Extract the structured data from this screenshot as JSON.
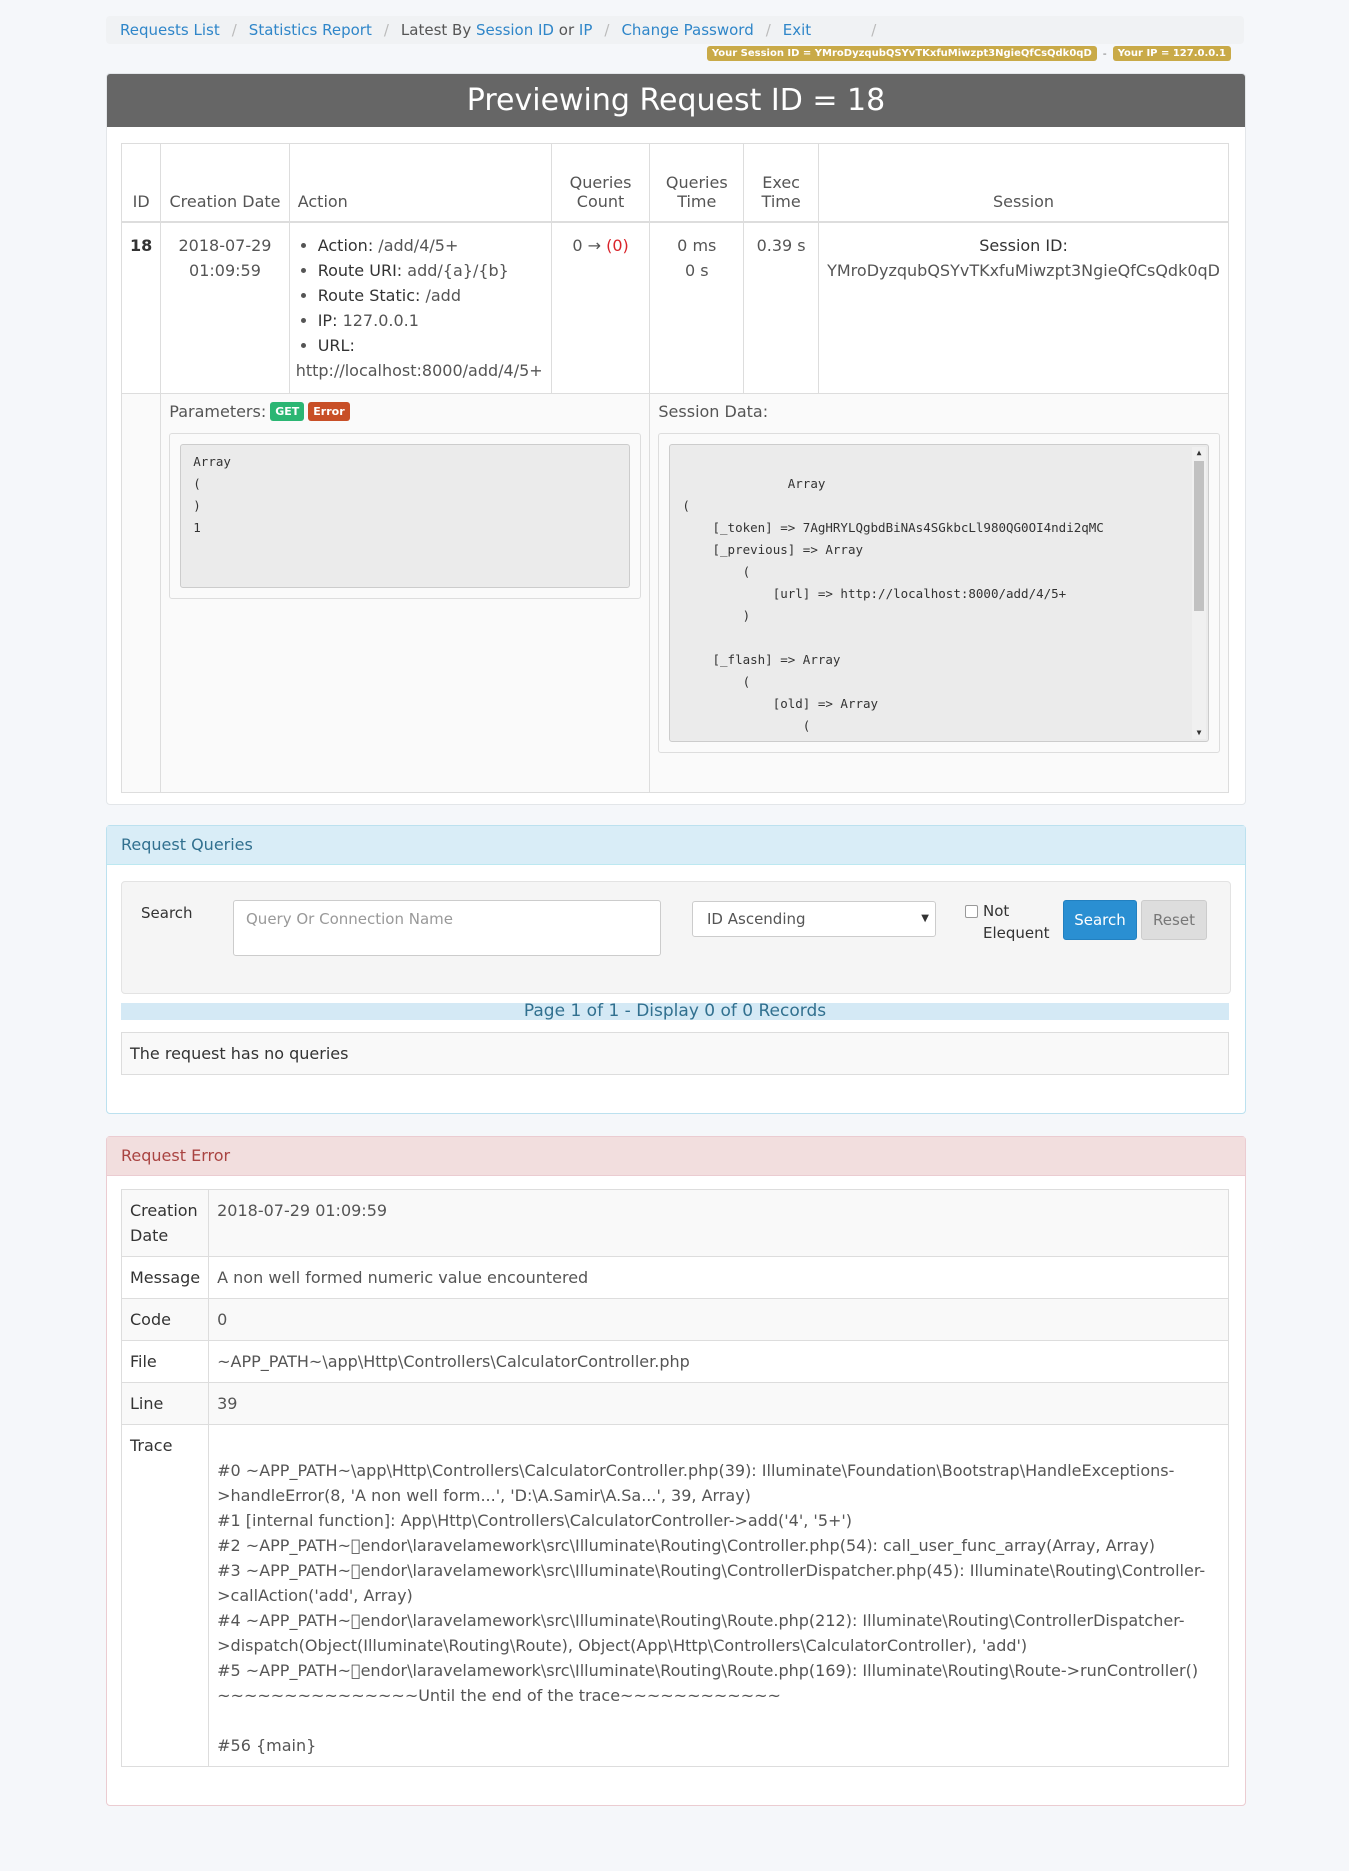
{
  "nav": {
    "requests_list": "Requests List",
    "statistics_report": "Statistics Report",
    "latest_by": "Latest By",
    "session_id": "Session ID",
    "or": "or",
    "ip": "IP",
    "change_password": "Change Password",
    "exit": "Exit"
  },
  "badges": {
    "session": "Your Session ID = YMroDyzqubQSYvTKxfuMiwzpt3NgieQfCsQdk0qD",
    "separator": "-",
    "ip": "Your IP = 127.0.0.1"
  },
  "title": "Previewing Request ID = 18",
  "table": {
    "headers": {
      "id": "ID",
      "creation_date": "Creation Date",
      "action": "Action",
      "queries_count_1": "Queries",
      "queries_count_2": "Count",
      "queries_time_1": "Queries",
      "queries_time_2": "Time",
      "exec_time_1": "Exec",
      "exec_time_2": "Time",
      "session": "Session"
    },
    "row": {
      "id": "18",
      "date_line1": "2018-07-29",
      "date_line2": "01:09:59",
      "action_label": "Action:",
      "action_value": "/add/4/5+",
      "route_uri_label": "Route URI:",
      "route_uri_value": "add/{a}/{b}",
      "route_static_label": "Route Static:",
      "route_static_value": "/add",
      "ip_label": "IP:",
      "ip_value": "127.0.0.1",
      "url_label": "URL:",
      "url_value": "http://localhost:8000/add/4/5+",
      "queries_count": "0 →",
      "queries_count_red": "(0)",
      "queries_time_ms": "0 ms",
      "queries_time_s": "0 s",
      "exec_time": "0.39 s",
      "session_label": "Session ID:",
      "session_value": "YMroDyzqubQSYvTKxfuMiwzpt3NgieQfCsQdk0qD"
    },
    "parameters_label": "Parameters:",
    "get_badge": "GET",
    "error_badge": "Error",
    "parameters_code": "Array\n(\n)\n1",
    "session_data_label": "Session Data:",
    "session_code": "Array\n(\n    [_token] => 7AgHRYLQgbdBiNAs4SGkbcLl980QG0OI4ndi2qMC\n    [_previous] => Array\n        (\n            [url] => http://localhost:8000/add/4/5+\n        )\n\n    [_flash] => Array\n        (\n            [old] => Array\n                (\n                )"
  },
  "queries": {
    "title": "Request Queries",
    "search_label": "Search",
    "search_placeholder": "Query Or Connection Name",
    "sort_value": "ID Ascending",
    "not_elequent_1": "Not",
    "not_elequent_2": "Elequent",
    "search_button": "Search",
    "reset_button": "Reset",
    "pager": "Page 1 of 1 - Display 0 of 0 Records",
    "empty": "The request has no queries"
  },
  "error": {
    "title": "Request Error",
    "rows": [
      {
        "key_line1": "Creation",
        "key_line2": "Date",
        "value": "2018-07-29 01:09:59"
      },
      {
        "key": "Message",
        "value": "A non well formed numeric value encountered"
      },
      {
        "key": "Code",
        "value": "0"
      },
      {
        "key": "File",
        "value": "~APP_PATH~\\app\\Http\\Controllers\\CalculatorController.php"
      },
      {
        "key": "Line",
        "value": "39"
      },
      {
        "key": "Trace",
        "value": "\n#0 ~APP_PATH~\\app\\Http\\Controllers\\CalculatorController.php(39): Illuminate\\Foundation\\Bootstrap\\HandleExceptions->handleError(8, 'A non well form...', 'D:\\A.Samir\\A.Sa...', 39, Array)\n#1 [internal function]: App\\Http\\Controllers\\CalculatorController->add('4', '5+')\n#2 ~APP_PATH~\u0000endor\\laravel\famework\\src\\Illuminate\\Routing\\Controller.php(54): call_user_func_array(Array, Array)\n#3 ~APP_PATH~\u0000endor\\laravel\famework\\src\\Illuminate\\Routing\\ControllerDispatcher.php(45): Illuminate\\Routing\\Controller->callAction('add', Array)\n#4 ~APP_PATH~\u0000endor\\laravel\famework\\src\\Illuminate\\Routing\\Route.php(212): Illuminate\\Routing\\ControllerDispatcher->dispatch(Object(Illuminate\\Routing\\Route), Object(App\\Http\\Controllers\\CalculatorController), 'add')\n#5 ~APP_PATH~\u0000endor\\laravel\famework\\src\\Illuminate\\Routing\\Route.php(169): Illuminate\\Routing\\Route->runController()\n~~~~~~~~~~~~~~~Until the end of the trace~~~~~~~~~~~~\n\n#56 {main}"
      }
    ]
  },
  "colors": {
    "link": "#2f86c9",
    "badge": "#c9aa48",
    "header_bg": "#666666",
    "get": "#2bb673",
    "error": "#c84f27",
    "search_btn": "#2a8fd2"
  }
}
